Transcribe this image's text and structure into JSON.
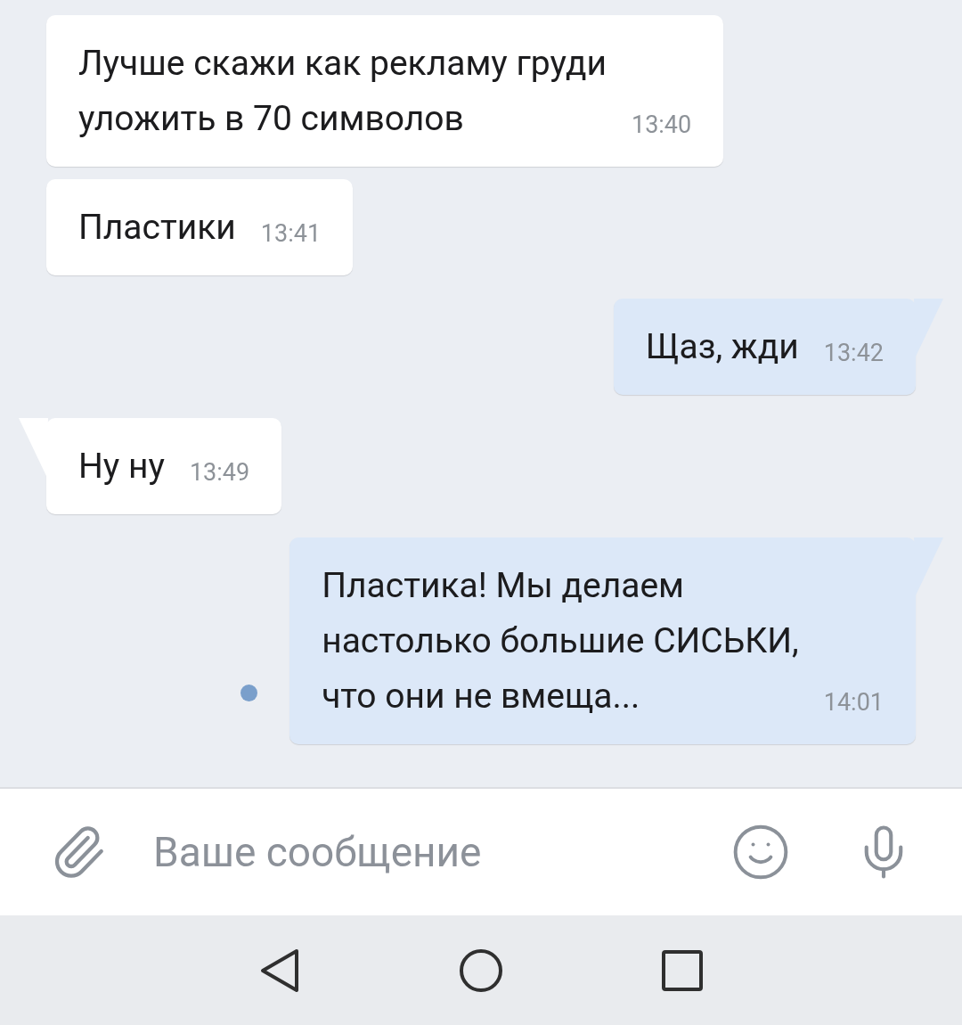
{
  "messages": [
    {
      "kind": "incoming",
      "lines": [
        "Лучше скажи как рекламу груди",
        "уложить в 70 символов"
      ],
      "time": "13:40",
      "tail": false,
      "unread": false
    },
    {
      "kind": "incoming",
      "lines": [
        "Пластики"
      ],
      "time": "13:41",
      "tail": false,
      "unread": false
    },
    {
      "kind": "outgoing",
      "lines": [
        "Щаз, жди"
      ],
      "time": "13:42",
      "tail": true,
      "unread": false
    },
    {
      "kind": "incoming",
      "lines": [
        "Ну ну"
      ],
      "time": "13:49",
      "tail": true,
      "unread": false
    },
    {
      "kind": "outgoing",
      "lines": [
        "Пластика! Мы делаем",
        "настолько большие СИСЬКИ,",
        "что они не вмеща..."
      ],
      "time": "14:01",
      "tail": true,
      "unread": true
    }
  ],
  "composer": {
    "placeholder": "Ваше сообщение"
  }
}
